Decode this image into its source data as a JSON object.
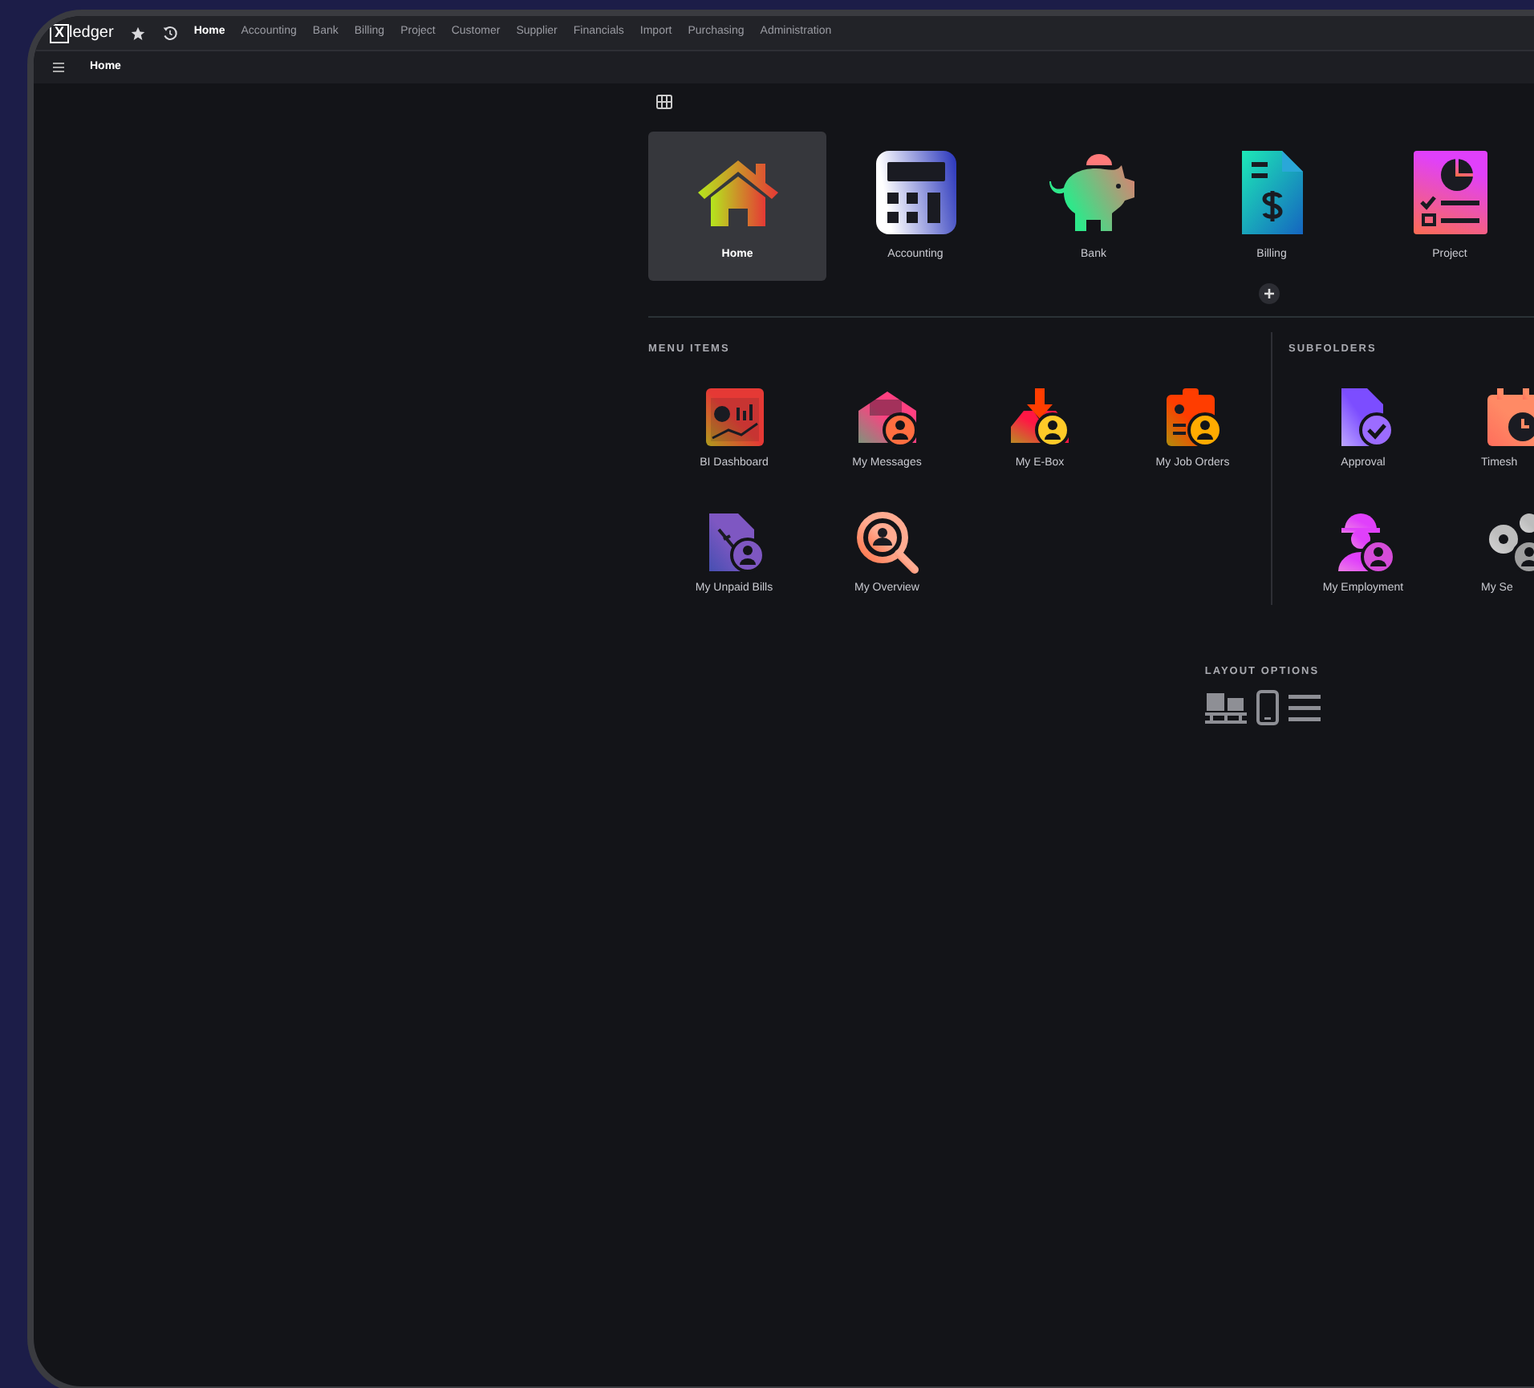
{
  "logo": {
    "mark": "X",
    "text": "ledger"
  },
  "nav": [
    {
      "label": "Home",
      "selected": true
    },
    {
      "label": "Accounting",
      "selected": false
    },
    {
      "label": "Bank",
      "selected": false
    },
    {
      "label": "Billing",
      "selected": false
    },
    {
      "label": "Project",
      "selected": false
    },
    {
      "label": "Customer",
      "selected": false
    },
    {
      "label": "Supplier",
      "selected": false
    },
    {
      "label": "Financials",
      "selected": false
    },
    {
      "label": "Import",
      "selected": false
    },
    {
      "label": "Purchasing",
      "selected": false
    },
    {
      "label": "Administration",
      "selected": false
    }
  ],
  "breadcrumb": "Home",
  "apps": [
    {
      "label": "Home",
      "selected": true
    },
    {
      "label": "Accounting",
      "selected": false
    },
    {
      "label": "Bank",
      "selected": false
    },
    {
      "label": "Billing",
      "selected": false
    },
    {
      "label": "Project",
      "selected": false
    }
  ],
  "menu_items": {
    "heading": "MENU ITEMS",
    "items": [
      "BI Dashboard",
      "My Messages",
      "My E-Box",
      "My Job Orders",
      "My Unpaid Bills",
      "My Overview"
    ]
  },
  "subfolders": {
    "heading": "SUBFOLDERS",
    "items": [
      "Approval",
      "Timesh",
      "My Employment",
      "My Se"
    ]
  },
  "layout_options": {
    "heading": "LAYOUT OPTIONS"
  }
}
